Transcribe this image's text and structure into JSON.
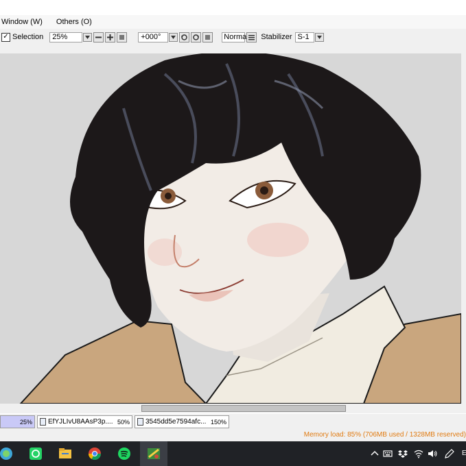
{
  "menu": {
    "window_label": "Window (W)",
    "others_label": "Others (O)"
  },
  "toolbar": {
    "selection_checked": true,
    "selection_label": "Selection",
    "zoom_value": "25%",
    "rotation_value": "+000°",
    "blend_mode": "Normal",
    "stabilizer_label": "Stabilizer",
    "stabilizer_value": "S-1",
    "icons": [
      "zoom-out-icon",
      "zoom-in-icon",
      "zoom-fit-icon",
      "rotate-left-icon",
      "rotate-right-icon",
      "rotate-reset-icon",
      "blend-mode-icon"
    ]
  },
  "canvas": {
    "content": "digital painting of a dark-haired character in a beige coat"
  },
  "tabs": [
    {
      "name": "",
      "zoom": "25%",
      "active": true
    },
    {
      "name": "EfYJLIvU8AAsP3p....",
      "zoom": "50%",
      "active": false
    },
    {
      "name": "3545dd5e7594afc...",
      "zoom": "150%",
      "active": false
    }
  ],
  "status": {
    "memory_load": "Memory load: 85% (706MB used / 1328MB reserved)",
    "memory_color": "#e07a10"
  },
  "taskbar": {
    "apps": [
      "edge-icon",
      "whatsapp-icon",
      "file-explorer-icon",
      "chrome-icon",
      "spotify-icon",
      "paint-tool-sai-icon"
    ],
    "tray": [
      "chevron-up-icon",
      "keyboard-icon",
      "dropbox-icon",
      "network-icon",
      "volume-icon",
      "pen-icon"
    ],
    "clock_fragment": "E"
  }
}
